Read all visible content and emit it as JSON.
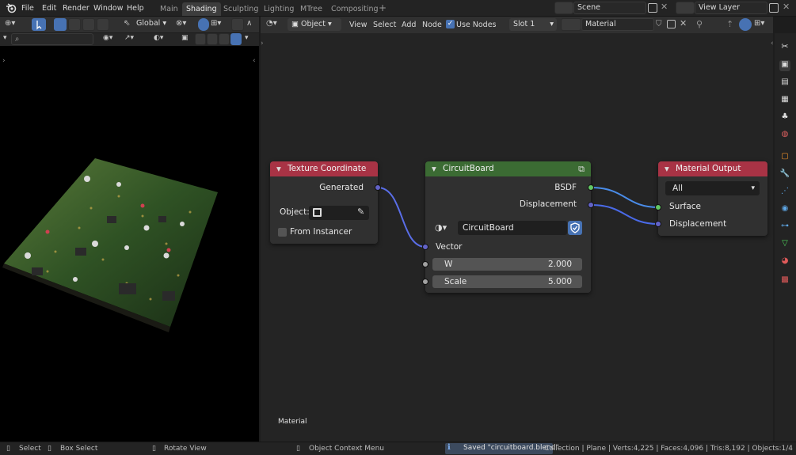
{
  "topbar": {
    "menus": [
      "File",
      "Edit",
      "Render",
      "Window",
      "Help"
    ],
    "workspaces": [
      "Main",
      "Shading",
      "Sculpting",
      "Lighting",
      "MTree",
      "Compositing"
    ],
    "active_workspace": "Shading",
    "add_workspace": "+",
    "scene_label": "Scene",
    "view_layer_label": "View Layer"
  },
  "viewport": {
    "transform_orientation": "Global",
    "context_label": "Material"
  },
  "node_editor": {
    "object_mode": "Object",
    "menus": [
      "View",
      "Select",
      "Add",
      "Node"
    ],
    "use_nodes_label": "Use Nodes",
    "use_nodes_checked": true,
    "slot": "Slot 1",
    "material_name": "Material"
  },
  "nodes": {
    "texture_coordinate": {
      "title": "Texture Coordinate",
      "output_generated": "Generated",
      "object_label": "Object:",
      "from_instancer": "From Instancer"
    },
    "circuitboard": {
      "title": "CircuitBoard",
      "output_bsdf": "BSDF",
      "output_displacement": "Displacement",
      "group_name": "CircuitBoard",
      "input_vector": "Vector",
      "w_label": "W",
      "w_value": "2.000",
      "scale_label": "Scale",
      "scale_value": "5.000"
    },
    "material_output": {
      "title": "Material Output",
      "target": "All",
      "input_surface": "Surface",
      "input_displacement": "Displacement"
    }
  },
  "statusbar": {
    "select": "Select",
    "box_select": "Box Select",
    "rotate_view": "Rotate View",
    "context_menu": "Object Context Menu",
    "saved_message": "Saved \"circuitboard.blend\"",
    "stats": "Collection | Plane | Verts:4,225 | Faces:4,096 | Tris:8,192 | Objects:1/4"
  },
  "colors": {
    "accent_blue": "#4772b3",
    "tex_coord_header": "#a83345",
    "group_header": "#3b6b33",
    "output_header": "#a83345",
    "socket_purple": "#6363c7",
    "socket_green": "#63c763",
    "socket_gray": "#a1a1a1"
  }
}
